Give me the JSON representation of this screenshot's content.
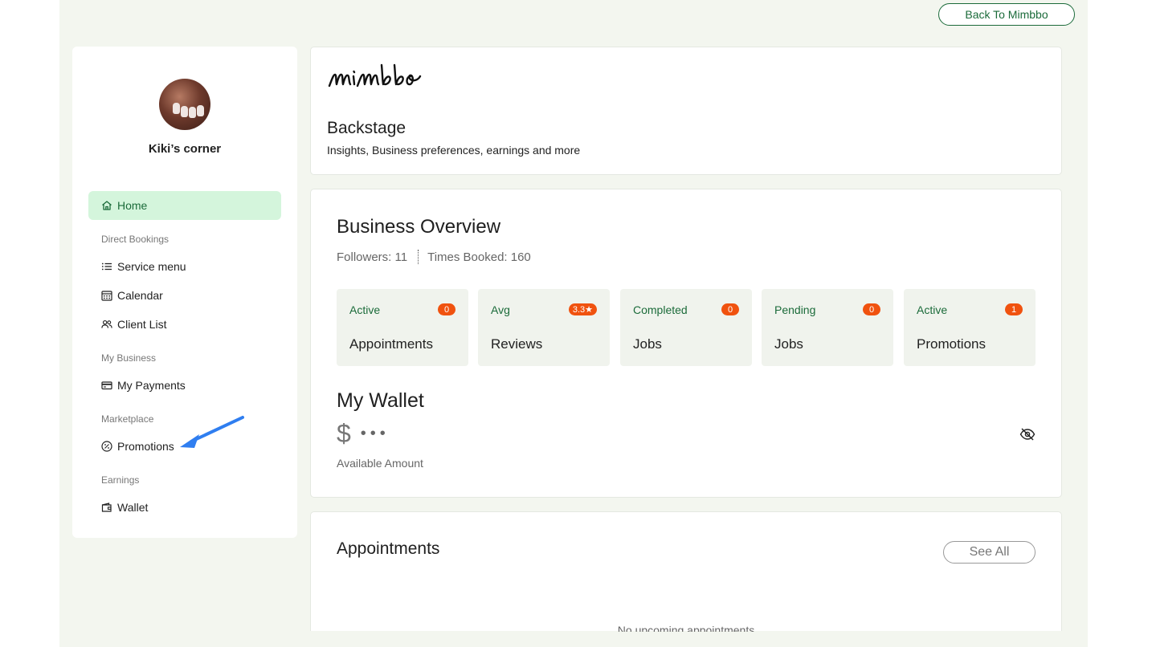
{
  "header": {
    "back_label": "Back To Mimbbo"
  },
  "sidebar": {
    "profile_name": "Kiki’s corner",
    "items": [
      {
        "label": "Home",
        "icon": "home-icon",
        "active": true
      },
      {
        "section": "Direct Bookings"
      },
      {
        "label": "Service menu",
        "icon": "list-icon"
      },
      {
        "label": "Calendar",
        "icon": "calendar-icon"
      },
      {
        "label": "Client List",
        "icon": "users-icon"
      },
      {
        "section": "My Business"
      },
      {
        "label": "My Payments",
        "icon": "credit-card-icon"
      },
      {
        "section": "Marketplace"
      },
      {
        "label": "Promotions",
        "icon": "percent-badge-icon"
      },
      {
        "section": "Earnings"
      },
      {
        "label": "Wallet",
        "icon": "wallet-icon"
      }
    ]
  },
  "backstage": {
    "logo_text": "mimbbo",
    "title": "Backstage",
    "subtitle": "Insights, Business preferences, earnings and more"
  },
  "overview": {
    "title": "Business Overview",
    "followers": "Followers: 11",
    "times_booked": "Times Booked: 160",
    "tiles": [
      {
        "top": "Active",
        "badge": "0",
        "bottom": "Appointments"
      },
      {
        "top": "Avg",
        "badge": "3.3★",
        "bottom": "Reviews"
      },
      {
        "top": "Completed",
        "badge": "0",
        "bottom": "Jobs"
      },
      {
        "top": "Pending",
        "badge": "0",
        "bottom": "Jobs"
      },
      {
        "top": "Active",
        "badge": "1",
        "bottom": "Promotions"
      }
    ]
  },
  "wallet": {
    "title": "My Wallet",
    "currency": "$",
    "masked": "•••",
    "label": "Available Amount"
  },
  "appointments": {
    "title": "Appointments",
    "see_all": "See All",
    "empty": "No upcoming appointments"
  },
  "colors": {
    "accent_green": "#1b6b3a",
    "active_bg": "#d4f5dc",
    "badge_orange": "#f0520f",
    "annotation_arrow": "#2f7ef0"
  }
}
